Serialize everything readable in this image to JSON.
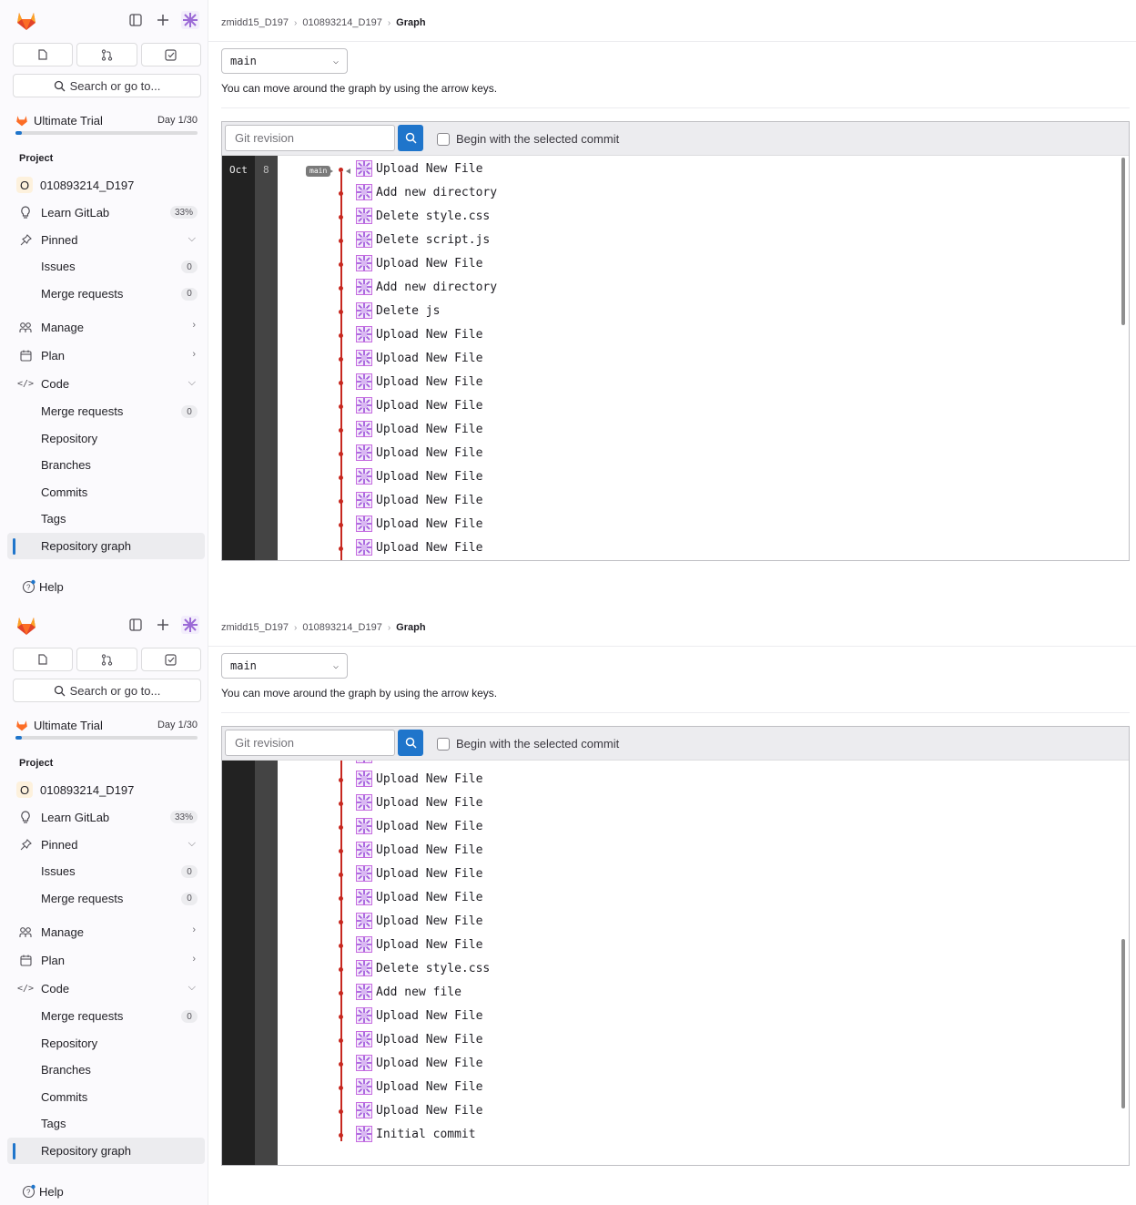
{
  "panels": [
    {
      "sidebar": {
        "trial": {
          "label": "Ultimate Trial",
          "day": "Day 1/30",
          "progress": 0.033
        },
        "search_label": "Search or go to...",
        "section_label": "Project",
        "project_initial": "O",
        "project_name": "010893214_D197",
        "learn": {
          "label": "Learn GitLab",
          "badge": "33%"
        },
        "pinned": {
          "label": "Pinned"
        },
        "pinned_items": [
          {
            "label": "Issues",
            "badge": "0"
          },
          {
            "label": "Merge requests",
            "badge": "0"
          }
        ],
        "manage": "Manage",
        "plan": "Plan",
        "code": "Code",
        "code_items": [
          {
            "label": "Merge requests",
            "badge": "0"
          },
          {
            "label": "Repository"
          },
          {
            "label": "Branches"
          },
          {
            "label": "Commits"
          },
          {
            "label": "Tags"
          },
          {
            "label": "Repository graph"
          }
        ],
        "help": "Help"
      },
      "breadcrumb": [
        "zmidd15_D197",
        "010893214_D197",
        "Graph"
      ],
      "branch": "main",
      "hint": "You can move around the graph by using the arrow keys.",
      "revision_placeholder": "Git revision",
      "begin_label": "Begin with the selected commit",
      "month": "Oct",
      "day": "8",
      "branch_tag": "main",
      "commits": [
        "Upload New File",
        "Add new directory",
        "Delete style.css",
        "Delete script.js",
        "Upload New File",
        "Add new directory",
        "Delete js",
        "Upload New File",
        "Upload New File",
        "Upload New File",
        "Upload New File",
        "Upload New File",
        "Upload New File",
        "Upload New File",
        "Upload New File",
        "Upload New File",
        "Upload New File"
      ]
    },
    {
      "sidebar": {
        "trial": {
          "label": "Ultimate Trial",
          "day": "Day 1/30",
          "progress": 0.033
        },
        "search_label": "Search or go to...",
        "section_label": "Project",
        "project_initial": "O",
        "project_name": "010893214_D197",
        "learn": {
          "label": "Learn GitLab",
          "badge": "33%"
        },
        "pinned": {
          "label": "Pinned"
        },
        "pinned_items": [
          {
            "label": "Issues",
            "badge": "0"
          },
          {
            "label": "Merge requests",
            "badge": "0"
          }
        ],
        "manage": "Manage",
        "plan": "Plan",
        "code": "Code",
        "code_items": [
          {
            "label": "Merge requests",
            "badge": "0"
          },
          {
            "label": "Repository"
          },
          {
            "label": "Branches"
          },
          {
            "label": "Commits"
          },
          {
            "label": "Tags"
          },
          {
            "label": "Repository graph"
          }
        ],
        "help": "Help"
      },
      "breadcrumb": [
        "zmidd15_D197",
        "010893214_D197",
        "Graph"
      ],
      "branch": "main",
      "hint": "You can move around the graph by using the arrow keys.",
      "revision_placeholder": "Git revision",
      "begin_label": "Begin with the selected commit",
      "commits": [
        "Upload New File",
        "Upload New File",
        "Upload New File",
        "Upload New File",
        "Upload New File",
        "Upload New File",
        "Upload New File",
        "Upload New File",
        "Delete style.css",
        "Add new file",
        "Upload New File",
        "Upload New File",
        "Upload New File",
        "Upload New File",
        "Upload New File",
        "Initial commit"
      ]
    }
  ],
  "colors": {
    "accent": "#1f75cb",
    "graph_line": "#c7271f",
    "month_col": "#222222",
    "day_col": "#444444"
  },
  "icons": [
    "gitlab-logo",
    "sidebar-toggle-icon",
    "plus-icon",
    "avatar-icon",
    "issues-icon",
    "merge-request-icon",
    "todo-icon",
    "search-icon",
    "trial-logo",
    "learn-icon",
    "pin-icon",
    "manage-icon",
    "plan-icon",
    "code-icon",
    "chevron-down-icon",
    "chevron-right-icon",
    "help-icon"
  ]
}
